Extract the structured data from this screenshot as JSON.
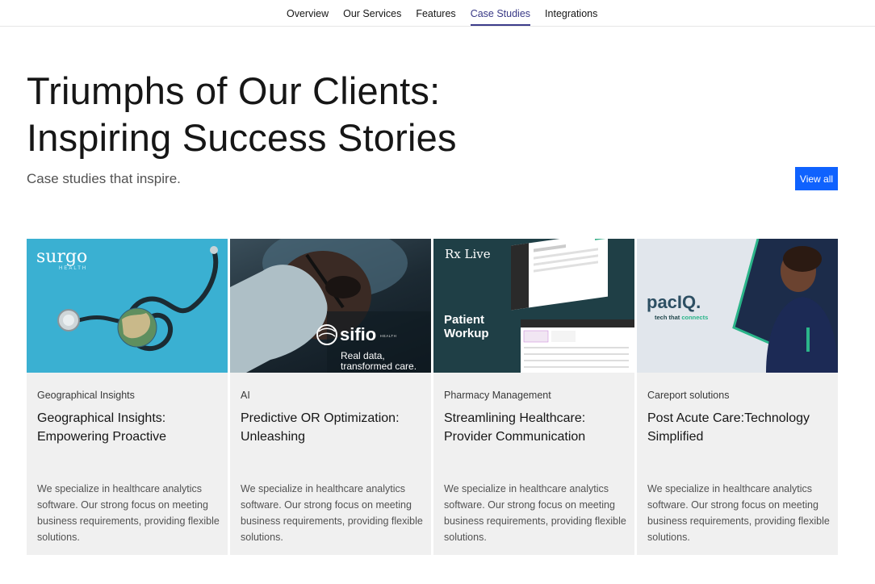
{
  "nav": {
    "items": [
      {
        "label": "Overview",
        "active": false
      },
      {
        "label": "Our Services",
        "active": false
      },
      {
        "label": "Features",
        "active": false
      },
      {
        "label": "Case Studies",
        "active": true
      },
      {
        "label": "Integrations",
        "active": false
      }
    ]
  },
  "hero": {
    "title_line1": "Triumphs of Our Clients:",
    "title_line2": "Inspiring Success Stories",
    "subtitle": "Case studies that inspire.",
    "view_all_label": "View all"
  },
  "cards": [
    {
      "tag": "Geographical Insights",
      "title": "Geographical Insights: Empowering Proactive",
      "description": "We specialize in healthcare analytics software. Our strong focus on meeting business requirements, providing flexible solutions.",
      "image": {
        "logo": "surgo",
        "logo_sub": "HEALTH",
        "icon": "stethoscope-globe-icon"
      }
    },
    {
      "tag": "AI",
      "title": "Predictive OR Optimization: Unleashing",
      "description": "We specialize in healthcare analytics software. Our strong focus on meeting business requirements, providing flexible solutions.",
      "image": {
        "logo": "sifio",
        "logo_sub": "HEALTH",
        "tagline": "Real data, transformed care.",
        "icon": "surgeon-photo"
      }
    },
    {
      "tag": "Pharmacy Management",
      "title": "Streamlining Healthcare: Provider Communication",
      "description": "We specialize in healthcare analytics software. Our strong focus on meeting business requirements, providing flexible solutions.",
      "image": {
        "logo": "Rx Live",
        "headline": "Patient Workup",
        "icon": "app-screenshot"
      }
    },
    {
      "tag": "Careport solutions",
      "title": "Post Acute Care:Technology Simplified",
      "description": "We specialize in healthcare analytics software. Our strong focus on meeting business requirements, providing flexible solutions.",
      "image": {
        "logo": "pacIQ.",
        "tagline_prefix": "tech that ",
        "tagline_accent": "connects",
        "icon": "nurse-photo"
      }
    }
  ],
  "colors": {
    "accent_blue": "#0f62fe",
    "nav_active": "#393986",
    "card_bg": "#f0f0f0",
    "paciq_green": "#2bb58a"
  }
}
